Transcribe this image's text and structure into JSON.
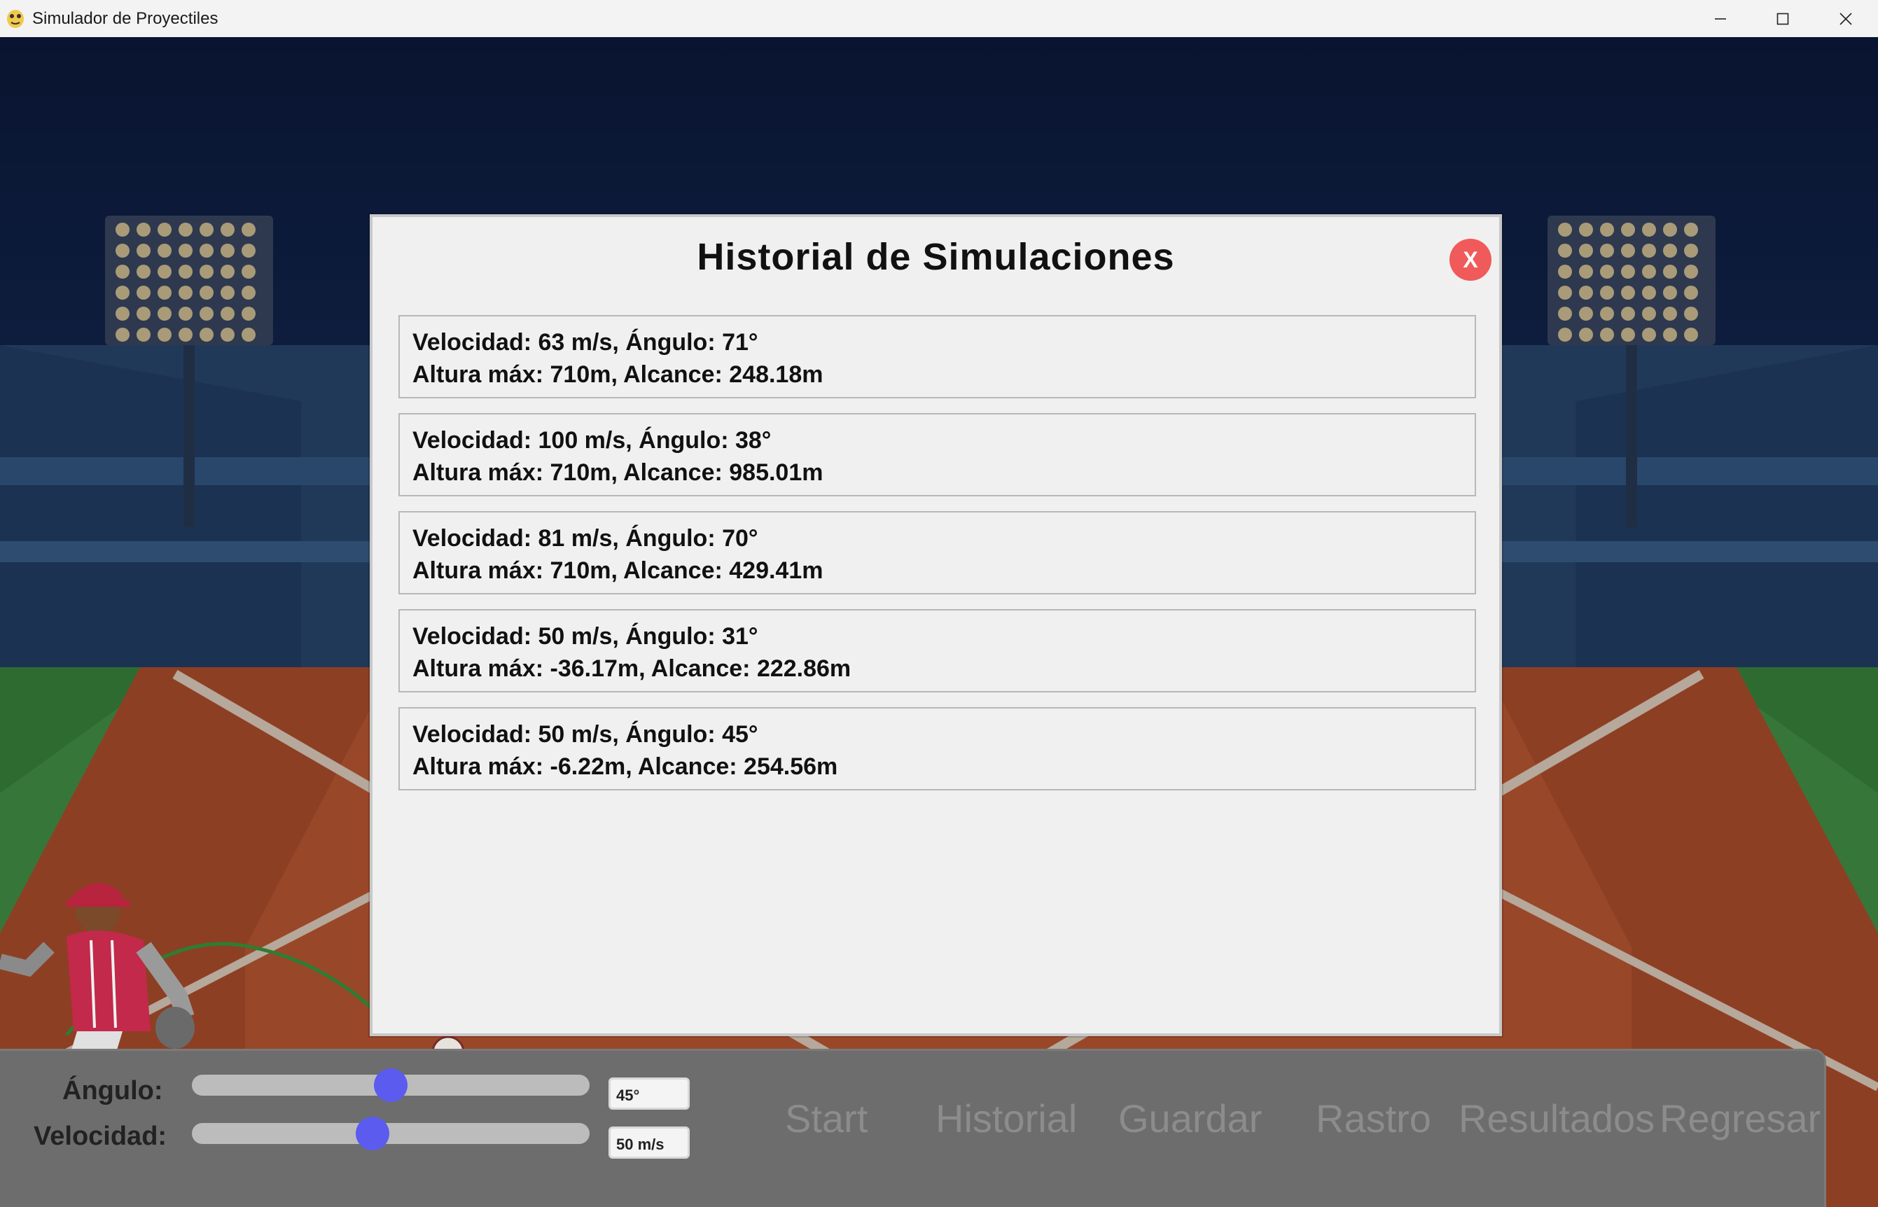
{
  "window": {
    "title": "Simulador de Proyectiles",
    "controls": [
      "minimize-icon",
      "maximize-icon",
      "close-icon"
    ]
  },
  "dialog": {
    "title": "Historial de Simulaciones",
    "close_label": "X",
    "records": [
      {
        "line1": "Velocidad: 63 m/s, Ángulo: 71°",
        "line2": "Altura máx: 710m, Alcance: 248.18m"
      },
      {
        "line1": "Velocidad: 100 m/s, Ángulo: 38°",
        "line2": "Altura máx: 710m, Alcance: 985.01m"
      },
      {
        "line1": "Velocidad: 81 m/s, Ángulo: 70°",
        "line2": "Altura máx: 710m, Alcance: 429.41m"
      },
      {
        "line1": "Velocidad: 50 m/s, Ángulo: 31°",
        "line2": "Altura máx: -36.17m, Alcance: 222.86m"
      },
      {
        "line1": "Velocidad: 50 m/s, Ángulo: 45°",
        "line2": "Altura máx: -6.22m, Alcance: 254.56m"
      }
    ]
  },
  "controls": {
    "angle_label": "Ángulo:",
    "angle_value": "45°",
    "angle_slider_fraction": 0.5,
    "velocity_label": "Velocidad:",
    "velocity_value": "50 m/s",
    "velocity_slider_fraction": 0.45,
    "buttons": [
      "Start",
      "Historial",
      "Guardar",
      "Rastro",
      "Resultados",
      "Regresar"
    ]
  },
  "colors": {
    "dialog_bg": "#f0f0f0",
    "close_button": "#f05a5a",
    "slider_thumb": "#5b5bf0",
    "panel_bg": "#6d6d6d",
    "trajectory": "#2e7d32"
  }
}
